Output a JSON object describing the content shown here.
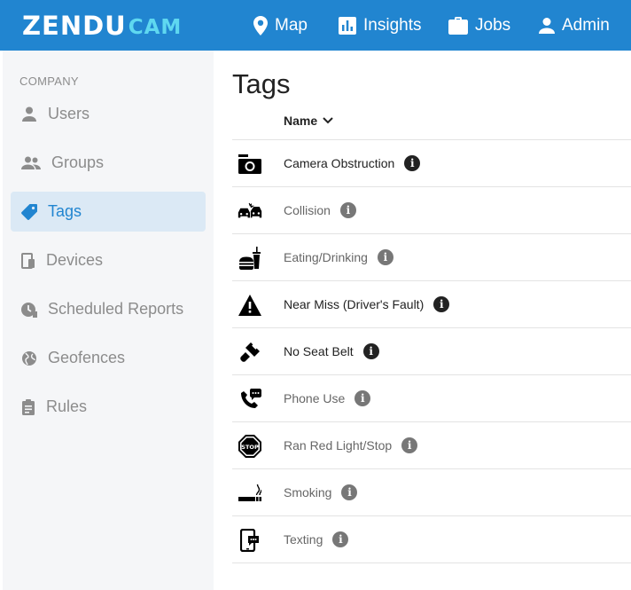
{
  "brand": {
    "part1": "ZENDU",
    "part2": "CAM"
  },
  "nav": {
    "map": "Map",
    "insights": "Insights",
    "jobs": "Jobs",
    "admin": "Admin"
  },
  "sidebar": {
    "section_label": "COMPANY",
    "items": [
      {
        "label": "Users",
        "icon": "person-icon"
      },
      {
        "label": "Groups",
        "icon": "group-icon"
      },
      {
        "label": "Tags",
        "icon": "tag-icon",
        "active": true
      },
      {
        "label": "Devices",
        "icon": "devices-icon"
      },
      {
        "label": "Scheduled Reports",
        "icon": "clock-icon"
      },
      {
        "label": "Geofences",
        "icon": "globe-icon"
      },
      {
        "label": "Rules",
        "icon": "clipboard-icon"
      }
    ]
  },
  "main": {
    "title": "Tags",
    "column_header": "Name",
    "tags": [
      {
        "name": "Camera Obstruction",
        "icon": "camera-icon",
        "info": "dark"
      },
      {
        "name": "Collision",
        "icon": "car-collision-icon",
        "info": "grey"
      },
      {
        "name": "Eating/Drinking",
        "icon": "food-drink-icon",
        "info": "grey"
      },
      {
        "name": "Near Miss (Driver's Fault)",
        "icon": "warning-icon",
        "info": "dark"
      },
      {
        "name": "No Seat Belt",
        "icon": "seatbelt-icon",
        "info": "dark"
      },
      {
        "name": "Phone Use",
        "icon": "phone-icon",
        "info": "grey"
      },
      {
        "name": "Ran Red Light/Stop",
        "icon": "stop-sign-icon",
        "info": "grey"
      },
      {
        "name": "Smoking",
        "icon": "smoking-icon",
        "info": "grey"
      },
      {
        "name": "Texting",
        "icon": "texting-icon",
        "info": "grey"
      }
    ]
  },
  "colors": {
    "brand_blue": "#2185d0",
    "brand_cam": "#5fd8f0",
    "sidebar_bg": "#f5f6f8",
    "active_bg": "#dbe9f5"
  }
}
